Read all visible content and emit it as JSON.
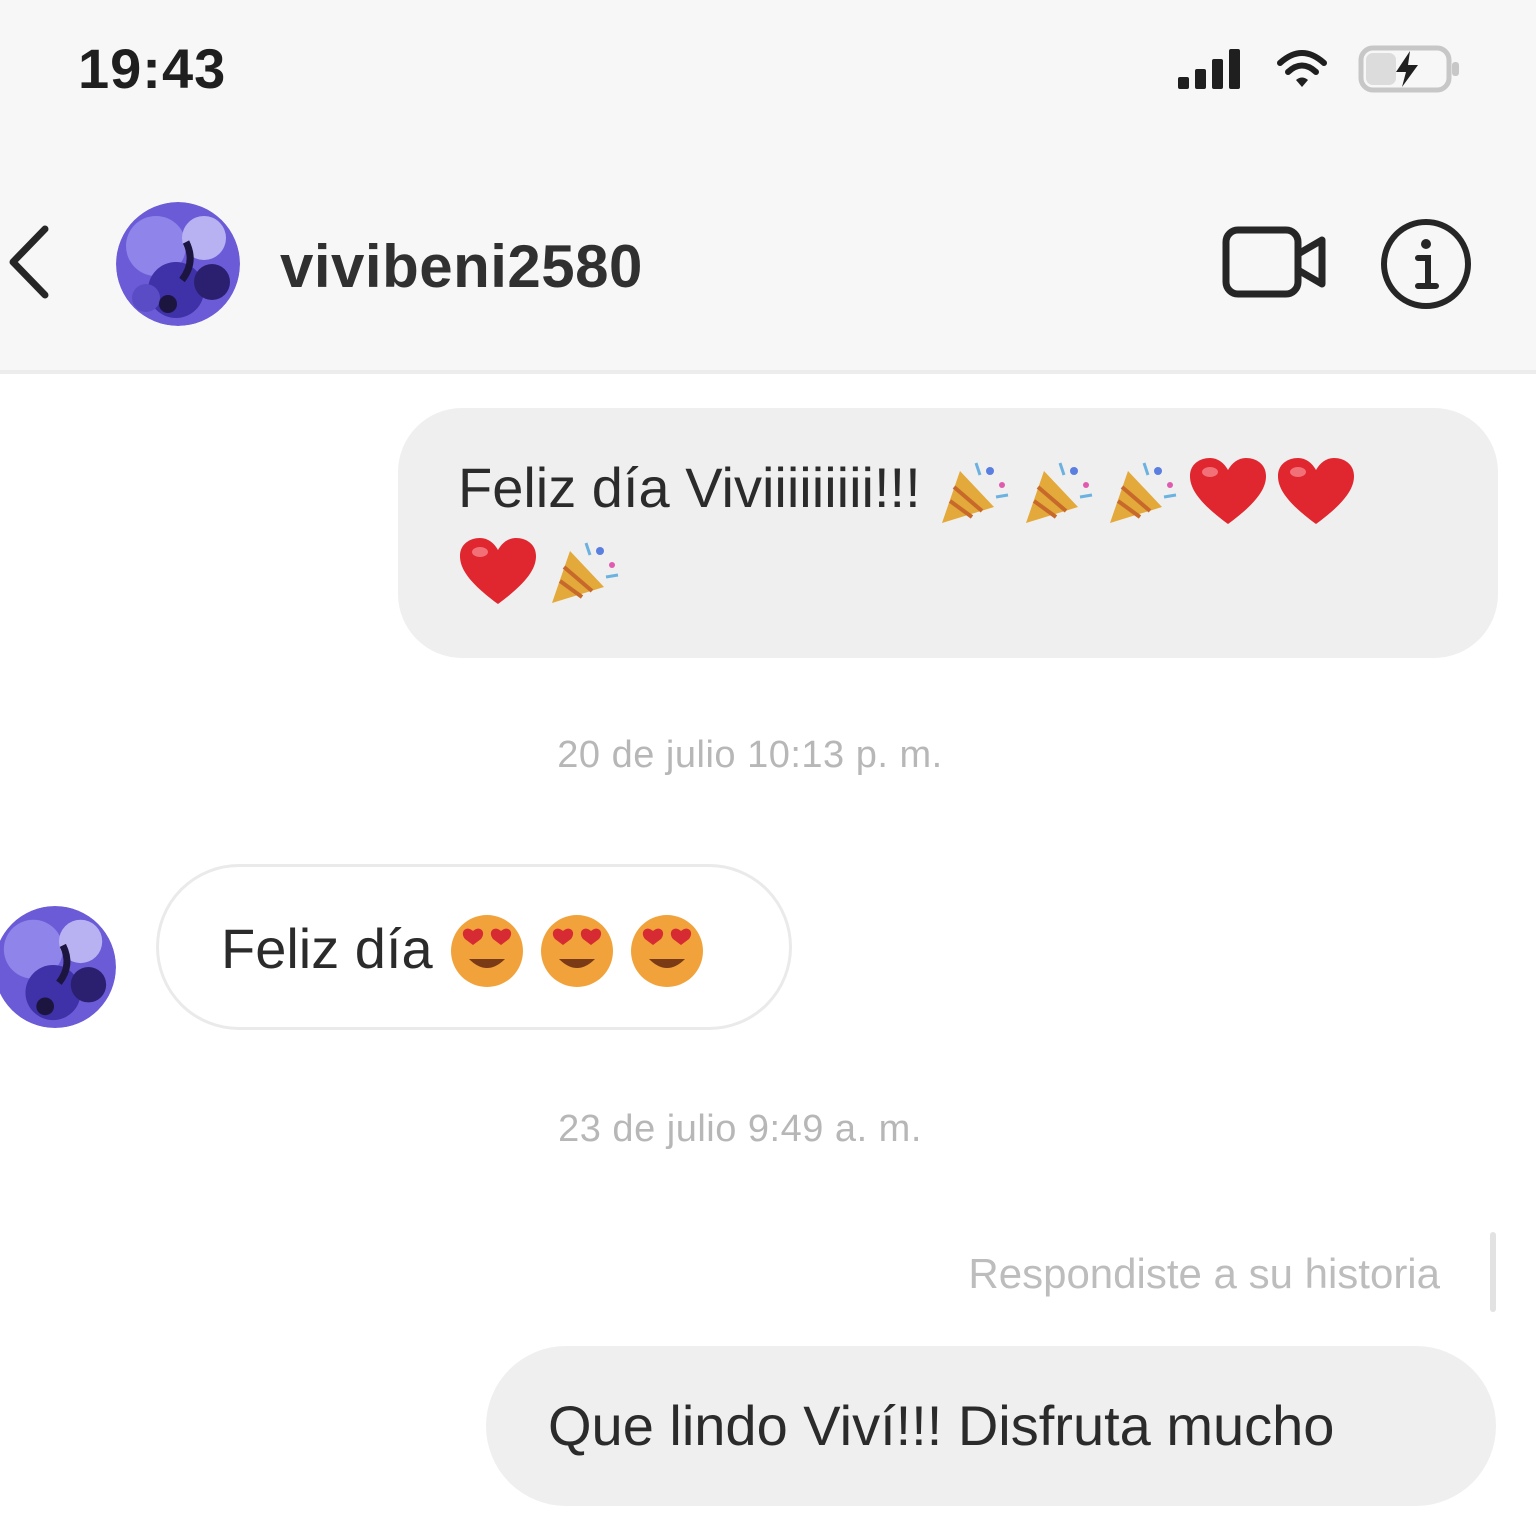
{
  "status_bar": {
    "time": "19:43"
  },
  "header": {
    "username": "vivibeni2580"
  },
  "messages": [
    {
      "direction": "outgoing",
      "text": "Feliz día Viviiiiiiiii!!!",
      "emojis": [
        "party-popper",
        "party-popper",
        "party-popper",
        "red-heart",
        "red-heart",
        "red-heart",
        "party-popper"
      ]
    },
    {
      "timestamp": "20 de julio 10:13 p. m."
    },
    {
      "direction": "incoming",
      "text": "Feliz día",
      "emojis": [
        "heart-eyes",
        "heart-eyes",
        "heart-eyes"
      ]
    },
    {
      "timestamp": "23 de julio 9:49 a. m."
    },
    {
      "note": "Respondiste a su historia"
    },
    {
      "direction": "outgoing",
      "text": "Que lindo Viví!!! Disfruta mucho"
    }
  ],
  "colors": {
    "header_bg": "#f8f7f8",
    "outgoing_bubble": "#efefef",
    "incoming_border": "#eaeaea",
    "timestamp": "#b7b7b7",
    "heart": "#e0262f"
  }
}
